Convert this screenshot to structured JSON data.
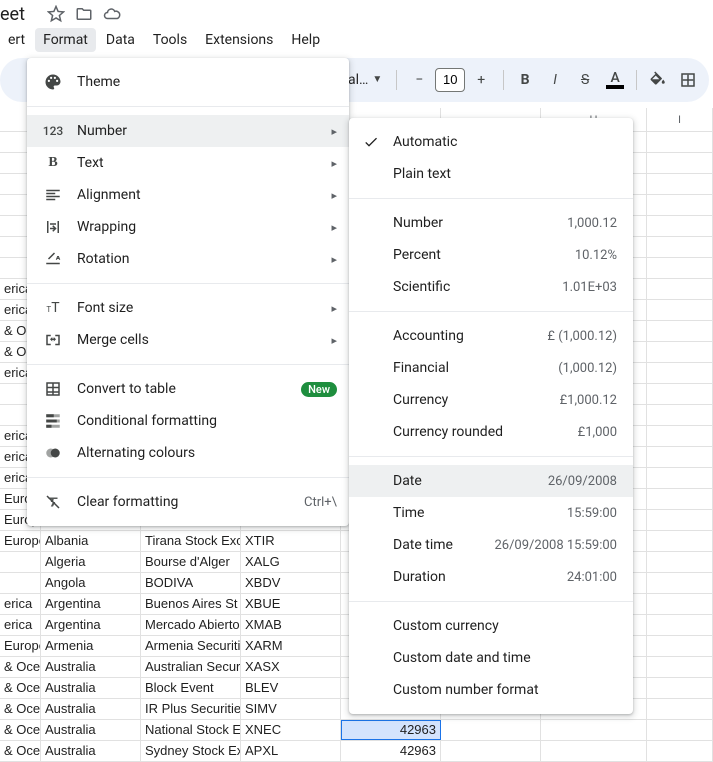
{
  "title_fragment": "eet",
  "menubar": [
    "ert",
    "Format",
    "Data",
    "Tools",
    "Extensions",
    "Help"
  ],
  "menubar_active_index": 1,
  "toolbar": {
    "font_dropdown_fragment": "al…",
    "font_size": "10",
    "text_color_underline": "#000000"
  },
  "format_menu": [
    {
      "icon": "theme-icon",
      "label": "Theme"
    },
    {
      "sep": true
    },
    {
      "icon": "number-icon",
      "label": "Number",
      "arrow": true,
      "highlight": true
    },
    {
      "icon": "text-icon",
      "label": "Text",
      "arrow": true
    },
    {
      "icon": "alignment-icon",
      "label": "Alignment",
      "arrow": true
    },
    {
      "icon": "wrapping-icon",
      "label": "Wrapping",
      "arrow": true
    },
    {
      "icon": "rotation-icon",
      "label": "Rotation",
      "arrow": true
    },
    {
      "sep": true
    },
    {
      "icon": "fontsize-icon",
      "label": "Font size",
      "arrow": true
    },
    {
      "icon": "merge-icon",
      "label": "Merge cells",
      "arrow": true
    },
    {
      "sep": true
    },
    {
      "icon": "table-icon",
      "label": "Convert to table",
      "badge": "New"
    },
    {
      "icon": "conditional-icon",
      "label": "Conditional formatting"
    },
    {
      "icon": "alternating-icon",
      "label": "Alternating colours"
    },
    {
      "sep": true
    },
    {
      "icon": "clear-icon",
      "label": "Clear formatting",
      "accel": "Ctrl+\\"
    }
  ],
  "number_submenu": [
    {
      "label": "Automatic",
      "checked": true
    },
    {
      "label": "Plain text"
    },
    {
      "sep": true
    },
    {
      "label": "Number",
      "example": "1,000.12"
    },
    {
      "label": "Percent",
      "example": "10.12%"
    },
    {
      "label": "Scientific",
      "example": "1.01E+03"
    },
    {
      "sep": true
    },
    {
      "label": "Accounting",
      "example": "£ (1,000.12)"
    },
    {
      "label": "Financial",
      "example": "(1,000.12)"
    },
    {
      "label": "Currency",
      "example": "£1,000.12"
    },
    {
      "label": "Currency rounded",
      "example": "£1,000"
    },
    {
      "sep": true
    },
    {
      "label": "Date",
      "example": "26/09/2008",
      "highlight": true
    },
    {
      "label": "Time",
      "example": "15:59:00"
    },
    {
      "label": "Date time",
      "example": "26/09/2008 15:59:00"
    },
    {
      "label": "Duration",
      "example": "24:01:00"
    },
    {
      "sep": true
    },
    {
      "label": "Custom currency"
    },
    {
      "label": "Custom date and time"
    },
    {
      "label": "Custom number format"
    }
  ],
  "column_headers": [
    "H",
    "I"
  ],
  "rows": [
    {
      "a": "",
      "b": "",
      "c": "",
      "d": "",
      "e": "",
      "f": ""
    },
    {
      "a": "",
      "b": "",
      "c": "",
      "d": "",
      "e": "",
      "f": ""
    },
    {
      "a": "",
      "b": "",
      "c": "",
      "d": "",
      "e": "",
      "f": ""
    },
    {
      "a": "",
      "b": "",
      "c": "",
      "d": "",
      "e": "",
      "f": ""
    },
    {
      "a": "",
      "b": "",
      "c": "",
      "d": "",
      "e": "",
      "f": ""
    },
    {
      "a": "",
      "b": "",
      "c": "",
      "d": "",
      "e": "",
      "f": ""
    },
    {
      "a": "",
      "b": "",
      "c": "",
      "d": "",
      "e": "",
      "f": ""
    },
    {
      "a": "erica",
      "b": "",
      "c": "",
      "d": "",
      "e": "",
      "f": ""
    },
    {
      "a": "erica",
      "b": "",
      "c": "",
      "d": "",
      "e": "",
      "f": ""
    },
    {
      "a": "& Oc",
      "b": "",
      "c": "",
      "d": "",
      "e": "",
      "f": ""
    },
    {
      "a": "& Oc",
      "b": "",
      "c": "",
      "d": "",
      "e": "",
      "f": ""
    },
    {
      "a": "erica",
      "b": "",
      "c": "",
      "d": "",
      "e": "",
      "f": ""
    },
    {
      "a": "",
      "b": "",
      "c": "",
      "d": "",
      "e": "",
      "f": ""
    },
    {
      "a": "",
      "b": "",
      "c": "",
      "d": "",
      "e": "",
      "f": ""
    },
    {
      "a": "erica",
      "b": "",
      "c": "",
      "d": "",
      "e": "",
      "f": ""
    },
    {
      "a": "erica",
      "b": "",
      "c": "",
      "d": "",
      "e": "",
      "f": ""
    },
    {
      "a": "erica",
      "b": "",
      "c": "",
      "d": "",
      "e": "",
      "f": ""
    },
    {
      "a": "Europ",
      "b": "",
      "c": "",
      "d": "",
      "e": "",
      "f": ""
    },
    {
      "a": "Europ",
      "b": "",
      "c": "",
      "d": "",
      "e": "",
      "f": ""
    },
    {
      "a": "Europe",
      "b": "Albania",
      "c": "Tirana Stock Exc",
      "d": "XTIR",
      "e": "",
      "f": ""
    },
    {
      "a": "",
      "b": "Algeria",
      "c": "Bourse d'Alger",
      "d": "XALG",
      "e": "",
      "f": ""
    },
    {
      "a": "",
      "b": "Angola",
      "c": "BODIVA",
      "d": "XBDV",
      "e": "",
      "f": ""
    },
    {
      "a": "erica",
      "b": "Argentina",
      "c": "Buenos Aires St",
      "d": "XBUE",
      "e": "",
      "f": ""
    },
    {
      "a": "erica",
      "b": "Argentina",
      "c": "Mercado Abierto",
      "d": "XMAB",
      "e": "",
      "f": ""
    },
    {
      "a": "Europe",
      "b": "Armenia",
      "c": "Armenia Securiti",
      "d": "XARM",
      "e": "",
      "f": ""
    },
    {
      "a": "& Ocea",
      "b": "Australia",
      "c": "Australian Secur",
      "d": "XASX",
      "e": "",
      "f": ""
    },
    {
      "a": "& Ocea",
      "b": "Australia",
      "c": "Block Event",
      "d": "BLEV",
      "e": "",
      "f": ""
    },
    {
      "a": "& Ocea",
      "b": "Australia",
      "c": "IR Plus Securitie",
      "d": "SIMV",
      "e": "",
      "f": ""
    },
    {
      "a": "& Ocea",
      "b": "Australia",
      "c": "National Stock E",
      "d": "XNEC",
      "e": "42963",
      "selE": true,
      "f": ""
    },
    {
      "a": "& Ocea",
      "b": "Australia",
      "c": "Sydney Stock Ex",
      "d": "APXL",
      "e": "42963",
      "f": ""
    }
  ]
}
